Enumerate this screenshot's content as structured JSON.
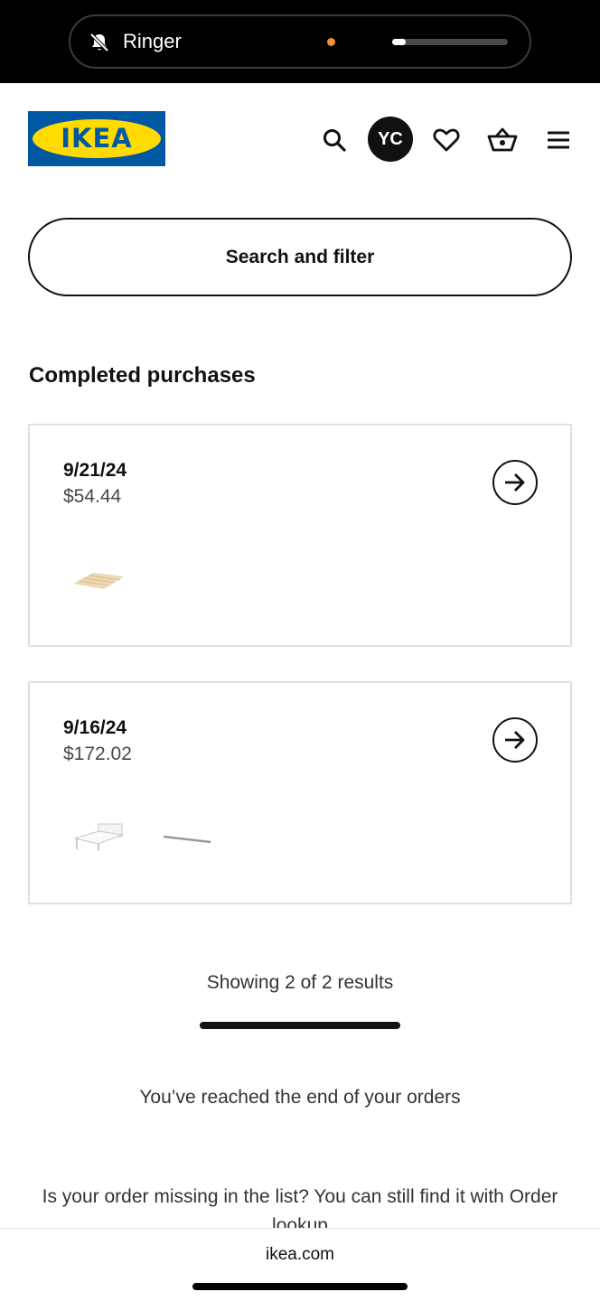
{
  "status_bar": {
    "mode_label": "Ringer",
    "volume_level": 0.12,
    "indicator_color": "#f0932b"
  },
  "header": {
    "logo_text": "IKEA",
    "avatar_initials": "YC",
    "icons": [
      "search-icon",
      "heart-icon",
      "basket-icon",
      "menu-icon"
    ]
  },
  "search": {
    "button_label": "Search and filter"
  },
  "section": {
    "title": "Completed purchases"
  },
  "orders": [
    {
      "date": "9/21/24",
      "total": "$54.44",
      "thumbnails": [
        "slatted-bed-base-image"
      ]
    },
    {
      "date": "9/16/24",
      "total": "$172.02",
      "thumbnails": [
        "bed-frame-image",
        "rail-image"
      ]
    }
  ],
  "pagination": {
    "summary": "Showing 2 of 2 results",
    "progress": 1.0
  },
  "footer": {
    "end_message": "You’ve reached the end of your orders",
    "missing_text": "Is your order missing in the list? You can still find it with",
    "lookup_link": "Order lookup"
  },
  "browser": {
    "url": "ikea.com"
  },
  "colors": {
    "brand_blue": "#0058a3",
    "brand_yellow": "#ffdb00"
  }
}
